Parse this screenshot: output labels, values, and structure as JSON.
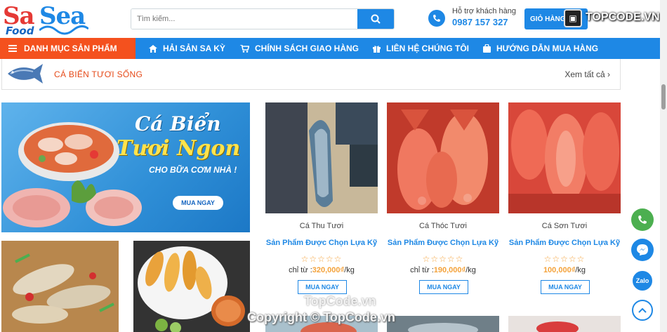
{
  "header": {
    "logo": {
      "sa": "Sa",
      "sea": "Sea",
      "food": "Food"
    },
    "search": {
      "placeholder": "Tìm kiếm..."
    },
    "support": {
      "label": "Hỗ trợ khách hàng",
      "phone": "0987 157 327"
    },
    "cart_label": "GIỎ HÀNG",
    "watermark_logo": "TOPCODE.VN"
  },
  "nav": {
    "category_label": "DANH MỤC SẢN PHẨM",
    "items": [
      {
        "label": "HẢI SẢN SA KỲ",
        "icon": "home-icon"
      },
      {
        "label": "CHÍNH SÁCH GIAO HÀNG",
        "icon": "cart-icon"
      },
      {
        "label": "LIÊN HỆ CHÚNG TÔI",
        "icon": "gift-icon"
      },
      {
        "label": "HƯỚNG DẪN MUA HÀNG",
        "icon": "bag-icon"
      }
    ]
  },
  "section": {
    "title": "CÁ BIỂN TƯƠI SỐNG",
    "more": "Xem tất cả ›"
  },
  "banner": {
    "line1": "Cá Biển",
    "line2": "Tươi Ngon",
    "line3": "CHO BỮA CƠM NHÀ !",
    "button": "MUA NGAY"
  },
  "products": [
    {
      "name": "Cá Thu Tươi",
      "tag": "Sản Phẩm Được Chọn Lựa Kỹ",
      "stars": "☆☆☆☆☆",
      "price_prefix": "chỉ từ :",
      "price": "320,000₫",
      "unit": "/kg",
      "button": "MUA NGAY"
    },
    {
      "name": "Cá Thóc Tươi",
      "tag": "Sản Phẩm Được Chọn Lựa Kỹ",
      "stars": "☆☆☆☆☆",
      "price_prefix": "chỉ từ :",
      "price": "190,000₫",
      "unit": "/kg",
      "button": "MUA NGAY"
    },
    {
      "name": "Cá Sơn Tươi",
      "tag": "Sản Phẩm Được Chọn Lựa Kỹ",
      "stars": "☆☆☆☆☆",
      "price_prefix": "",
      "price": "100,000₫",
      "unit": "/kg",
      "button": "MUA NGAY"
    }
  ],
  "watermark": {
    "line1": "TopCode.vn",
    "line2": "Copyright © TopCode.vn"
  },
  "colors": {
    "primary": "#1e88e5",
    "accent": "#f4511e",
    "price": "#f4a23a",
    "section_title": "#e64a19"
  }
}
